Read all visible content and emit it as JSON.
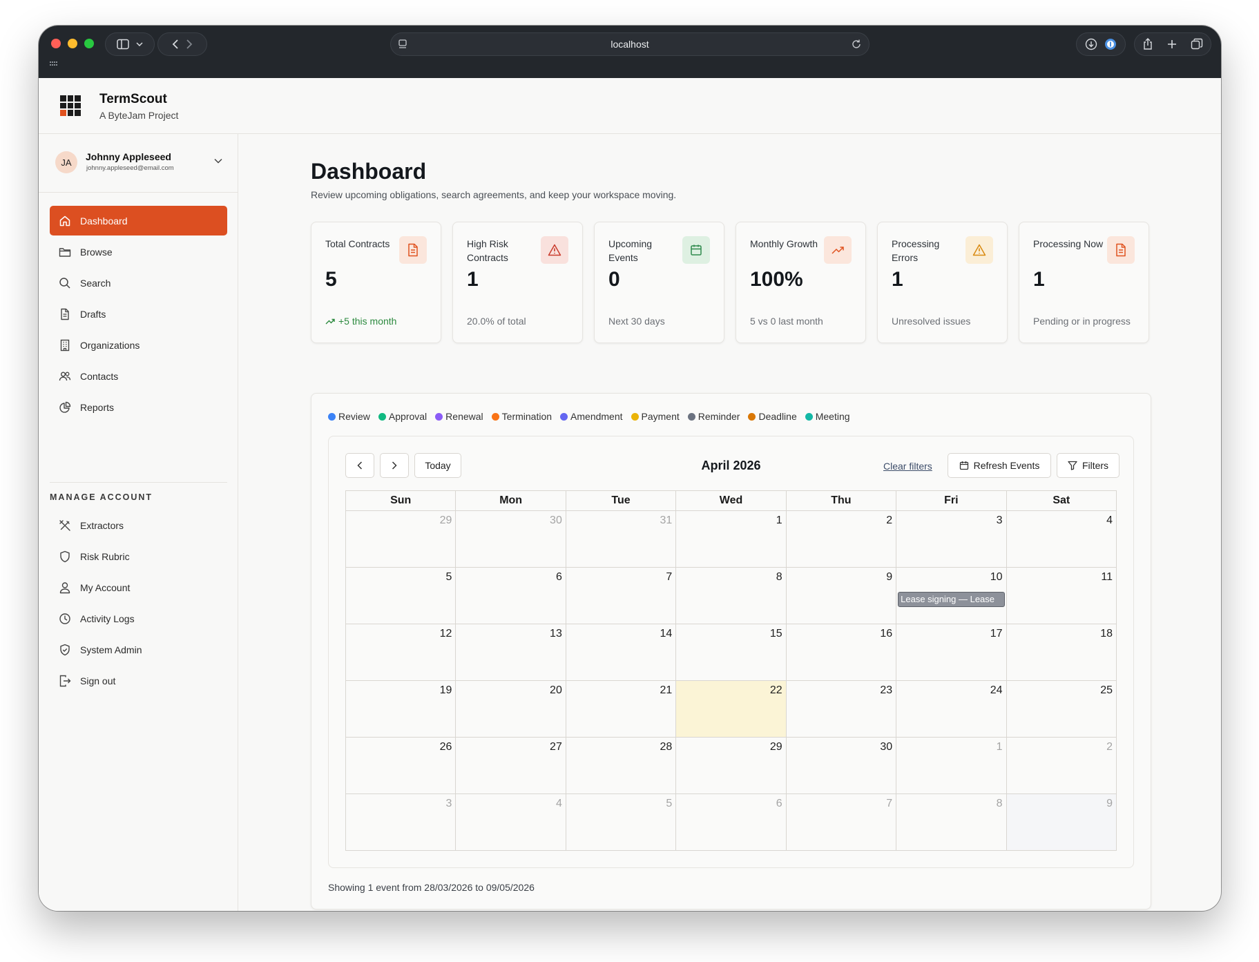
{
  "browser": {
    "url": "localhost"
  },
  "app": {
    "name": "TermScout",
    "subtitle": "A ByteJam Project"
  },
  "user": {
    "initials": "JA",
    "name": "Johnny Appleseed",
    "email": "johnny.appleseed@email.com"
  },
  "sidebar": {
    "items": [
      {
        "label": "Dashboard",
        "icon": "home-icon",
        "active": true
      },
      {
        "label": "Browse",
        "icon": "folder-icon"
      },
      {
        "label": "Search",
        "icon": "search-icon"
      },
      {
        "label": "Drafts",
        "icon": "document-icon"
      },
      {
        "label": "Organizations",
        "icon": "building-icon"
      },
      {
        "label": "Contacts",
        "icon": "users-icon"
      },
      {
        "label": "Reports",
        "icon": "pie-chart-icon"
      }
    ],
    "manage_label": "MANAGE ACCOUNT",
    "manage_items": [
      {
        "label": "Extractors",
        "icon": "tools-icon"
      },
      {
        "label": "Risk Rubric",
        "icon": "shield-icon"
      },
      {
        "label": "My Account",
        "icon": "user-icon"
      },
      {
        "label": "Activity Logs",
        "icon": "clock-icon"
      },
      {
        "label": "System Admin",
        "icon": "shield-check-icon"
      },
      {
        "label": "Sign out",
        "icon": "sign-out-icon"
      }
    ]
  },
  "main": {
    "title": "Dashboard",
    "subtitle": "Review upcoming obligations, search agreements, and keep your workspace moving."
  },
  "stats": [
    {
      "label": "Total Contracts",
      "value": "5",
      "note": "+5 this month",
      "icon": "file-icon",
      "icon_color": "#e0521f",
      "icon_bg": "#fbe6dc"
    },
    {
      "label": "High Risk Contracts",
      "value": "1",
      "note": "20.0% of total",
      "icon": "alert-triangle-icon",
      "icon_color": "#c93b2c",
      "icon_bg": "#f9e1dd"
    },
    {
      "label": "Upcoming Events",
      "value": "0",
      "note": "Next 30 days",
      "icon": "calendar-icon",
      "icon_color": "#2f8a4d",
      "icon_bg": "#def0e2"
    },
    {
      "label": "Monthly Growth",
      "value": "100%",
      "note": "5 vs 0 last month",
      "icon": "trending-up-icon",
      "icon_color": "#e0521f",
      "icon_bg": "#fbe6dc"
    },
    {
      "label": "Processing Errors",
      "value": "1",
      "note": "Unresolved issues",
      "icon": "alert-triangle-icon",
      "icon_color": "#d98a10",
      "icon_bg": "#fbeed6"
    },
    {
      "label": "Processing Now",
      "value": "1",
      "note": "Pending or in progress",
      "icon": "file-icon",
      "icon_color": "#e0521f",
      "icon_bg": "#fbe6dc"
    }
  ],
  "calendar": {
    "legend": [
      {
        "label": "Review",
        "color": "#3b82f6"
      },
      {
        "label": "Approval",
        "color": "#10b981"
      },
      {
        "label": "Renewal",
        "color": "#8b5cf6"
      },
      {
        "label": "Termination",
        "color": "#f97316"
      },
      {
        "label": "Amendment",
        "color": "#6366f1"
      },
      {
        "label": "Payment",
        "color": "#eab308"
      },
      {
        "label": "Reminder",
        "color": "#6b7280"
      },
      {
        "label": "Deadline",
        "color": "#d97706"
      },
      {
        "label": "Meeting",
        "color": "#14b8a6"
      }
    ],
    "today_label": "Today",
    "month_title": "April 2026",
    "clear_filters": "Clear filters",
    "refresh_label": "Refresh Events",
    "filters_label": "Filters",
    "weekdays": [
      "Sun",
      "Mon",
      "Tue",
      "Wed",
      "Thu",
      "Fri",
      "Sat"
    ],
    "days": [
      {
        "n": "29",
        "other": true
      },
      {
        "n": "30",
        "other": true
      },
      {
        "n": "31",
        "other": true
      },
      {
        "n": "1"
      },
      {
        "n": "2"
      },
      {
        "n": "3"
      },
      {
        "n": "4"
      },
      {
        "n": "5"
      },
      {
        "n": "6"
      },
      {
        "n": "7"
      },
      {
        "n": "8"
      },
      {
        "n": "9"
      },
      {
        "n": "10",
        "event": "Lease signing — Lease"
      },
      {
        "n": "11"
      },
      {
        "n": "12"
      },
      {
        "n": "13"
      },
      {
        "n": "14"
      },
      {
        "n": "15"
      },
      {
        "n": "16"
      },
      {
        "n": "17"
      },
      {
        "n": "18"
      },
      {
        "n": "19"
      },
      {
        "n": "20"
      },
      {
        "n": "21"
      },
      {
        "n": "22",
        "today": true
      },
      {
        "n": "23"
      },
      {
        "n": "24"
      },
      {
        "n": "25"
      },
      {
        "n": "26"
      },
      {
        "n": "27"
      },
      {
        "n": "28"
      },
      {
        "n": "29"
      },
      {
        "n": "30"
      },
      {
        "n": "1",
        "other": true
      },
      {
        "n": "2",
        "other": true
      },
      {
        "n": "3",
        "other": true
      },
      {
        "n": "4",
        "other": true
      },
      {
        "n": "5",
        "other": true
      },
      {
        "n": "6",
        "other": true
      },
      {
        "n": "7",
        "other": true
      },
      {
        "n": "8",
        "other": true
      },
      {
        "n": "9",
        "other": true
      }
    ],
    "showing": "Showing 1 event from 28/03/2026 to 09/05/2026"
  }
}
